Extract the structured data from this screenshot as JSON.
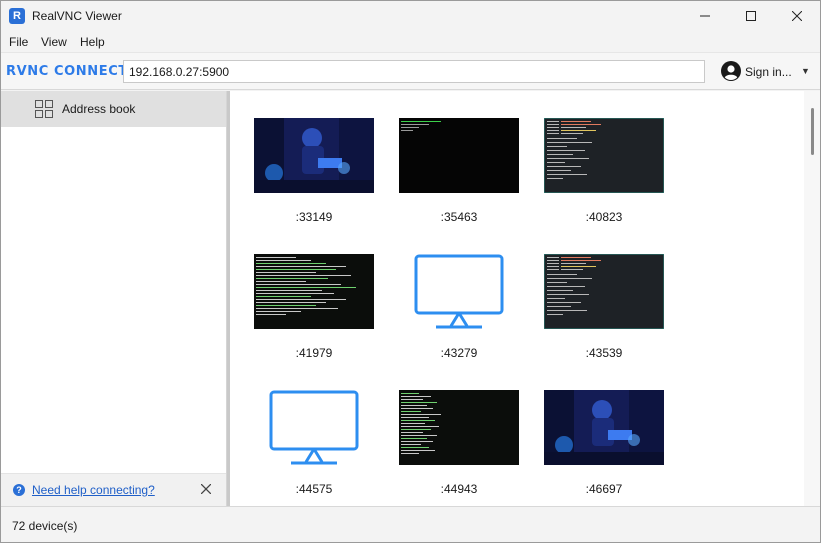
{
  "window": {
    "title": "RealVNC Viewer",
    "app_icon_glyph": "R"
  },
  "menu": [
    {
      "label": "File"
    },
    {
      "label": "View"
    },
    {
      "label": "Help"
    }
  ],
  "toolbar": {
    "logo_text": "RVNC CONNECT",
    "address_value": "192.168.0.27:5900",
    "signin_label": "Sign in...",
    "signin_caret": "▼"
  },
  "sidebar": {
    "items": [
      {
        "label": "Address book",
        "icon": "grid-icon"
      }
    ],
    "help": {
      "icon_glyph": "?",
      "link": "Need help connecting?"
    }
  },
  "devices": [
    {
      "label": ":33149",
      "thumb": "art"
    },
    {
      "label": ":35463",
      "thumb": "black"
    },
    {
      "label": ":40823",
      "thumb": "term-dark"
    },
    {
      "label": ":41979",
      "thumb": "term-green"
    },
    {
      "label": ":43279",
      "thumb": "monitor-icon"
    },
    {
      "label": ":43539",
      "thumb": "term-dark"
    },
    {
      "label": ":44575",
      "thumb": "monitor-icon"
    },
    {
      "label": ":44943",
      "thumb": "term-green"
    },
    {
      "label": ":46697",
      "thumb": "art"
    }
  ],
  "status": {
    "device_count": "72 device(s)"
  },
  "colors": {
    "accent": "#2d7be8",
    "link": "#1f5fc8",
    "selected": "#e0e0e0"
  }
}
